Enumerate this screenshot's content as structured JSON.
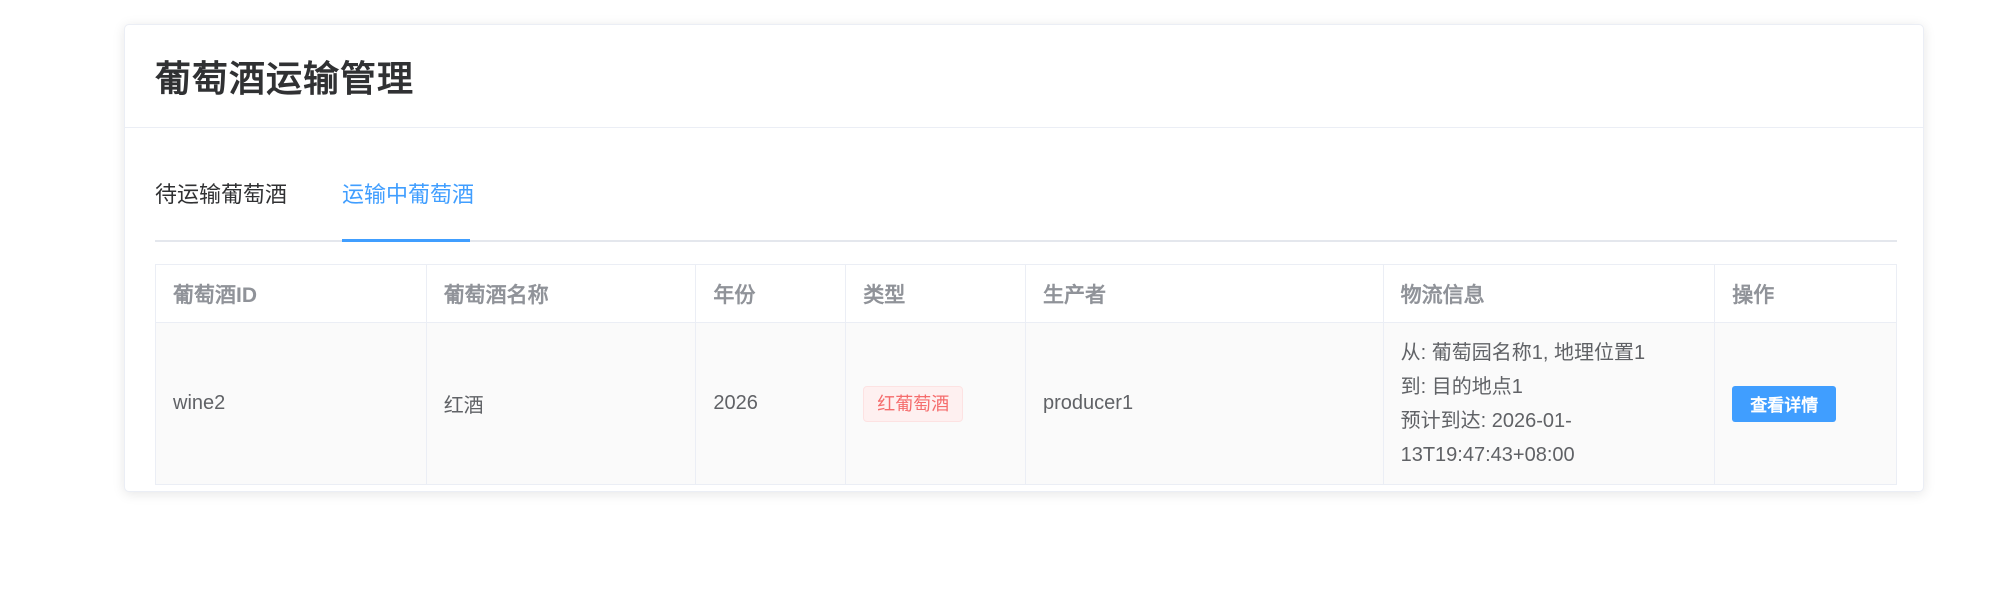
{
  "page": {
    "title": "葡萄酒运输管理"
  },
  "tabs": [
    {
      "label": "待运输葡萄酒",
      "active": false
    },
    {
      "label": "运输中葡萄酒",
      "active": true
    }
  ],
  "table": {
    "columns": [
      "葡萄酒ID",
      "葡萄酒名称",
      "年份",
      "类型",
      "生产者",
      "物流信息",
      "操作"
    ],
    "rows": [
      {
        "id": "wine2",
        "name": "红酒",
        "year": "2026",
        "type": "红葡萄酒",
        "producer": "producer1",
        "logistics": {
          "from": "从: 葡萄园名称1, 地理位置1",
          "to": "到: 目的地点1",
          "eta_line1": "预计到达: 2026-01-",
          "eta_line2": "13T19:47:43+08:00"
        },
        "action": "查看详情"
      }
    ]
  },
  "colors": {
    "accent": "#409eff",
    "tag_text": "#f56c6c",
    "tag_bg": "#fef0f0"
  }
}
